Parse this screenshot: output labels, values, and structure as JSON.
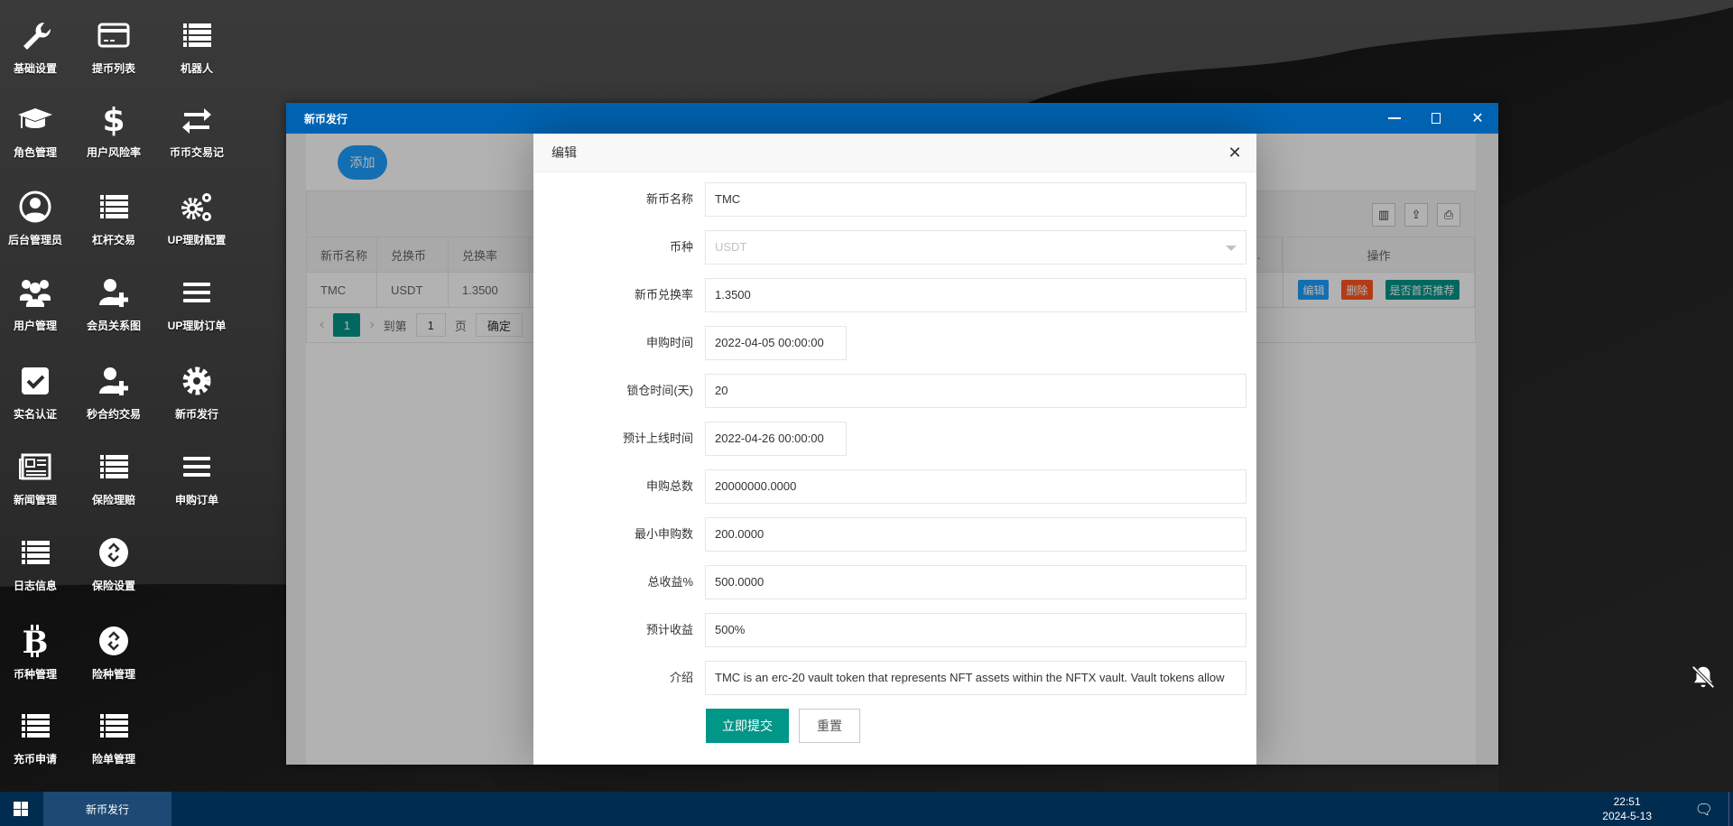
{
  "desktop": {
    "icons": [
      {
        "label": "基础设置",
        "icon": "wrench-icon"
      },
      {
        "label": "提币列表",
        "icon": "credit-card-icon"
      },
      {
        "label": "机器人",
        "icon": "list-icon"
      },
      {
        "label": "角色管理",
        "icon": "graduation-cap-icon"
      },
      {
        "label": "用户风险率",
        "icon": "dollar-icon"
      },
      {
        "label": "币币交易记",
        "icon": "exchange-icon"
      },
      {
        "label": "后台管理员",
        "icon": "user-circle-icon"
      },
      {
        "label": "杠杆交易",
        "icon": "list-icon"
      },
      {
        "label": "UP理财配置",
        "icon": "gears-icon"
      },
      {
        "label": "用户管理",
        "icon": "users-icon"
      },
      {
        "label": "会员关系图",
        "icon": "user-plus-icon"
      },
      {
        "label": "UP理财订单",
        "icon": "bars-icon"
      },
      {
        "label": "实名认证",
        "icon": "check-square-icon"
      },
      {
        "label": "秒合约交易",
        "icon": "user-plus-icon"
      },
      {
        "label": "新币发行",
        "icon": "gear-icon"
      },
      {
        "label": "新闻管理",
        "icon": "newspaper-icon"
      },
      {
        "label": "保险理赔",
        "icon": "list-icon"
      },
      {
        "label": "申购订单",
        "icon": "bars-icon"
      },
      {
        "label": "日志信息",
        "icon": "list-icon"
      },
      {
        "label": "保险设置",
        "icon": "link-circle-icon"
      },
      {
        "label": "币种管理",
        "icon": "bitcoin-icon"
      },
      {
        "label": "险种管理",
        "icon": "link-circle-icon"
      },
      {
        "label": "充币申请",
        "icon": "list-icon"
      },
      {
        "label": "险单管理",
        "icon": "list-icon"
      }
    ]
  },
  "window": {
    "title": "新币发行",
    "add_label": "添加",
    "table": {
      "columns": [
        "新币名称",
        "兑换币",
        "兑换率",
        "…",
        "操作"
      ],
      "rows": [
        {
          "name": "TMC",
          "currency": "USDT",
          "rate": "1.3500"
        }
      ],
      "actions": {
        "edit": "编辑",
        "delete": "删除",
        "recommend": "是否首页推荐"
      }
    },
    "pager": {
      "current": "1",
      "goto": "到第",
      "page_input": "1",
      "page_unit": "页",
      "confirm": "确定"
    }
  },
  "dialog": {
    "title": "编辑",
    "fields": [
      {
        "label": "新币名称",
        "value": "TMC",
        "type": "text"
      },
      {
        "label": "币种",
        "value": "USDT",
        "type": "select"
      },
      {
        "label": "新币兑换率",
        "value": "1.3500",
        "type": "text"
      },
      {
        "label": "申购时间",
        "value": "2022-04-05 00:00:00",
        "type": "date"
      },
      {
        "label": "锁仓时间(天)",
        "value": "20",
        "type": "text"
      },
      {
        "label": "预计上线时间",
        "value": "2022-04-26 00:00:00",
        "type": "date"
      },
      {
        "label": "申购总数",
        "value": "20000000.0000",
        "type": "text"
      },
      {
        "label": "最小申购数",
        "value": "200.0000",
        "type": "text"
      },
      {
        "label": "总收益%",
        "value": "500.0000",
        "type": "text"
      },
      {
        "label": "预计收益",
        "value": "500%",
        "type": "text"
      },
      {
        "label": "介绍",
        "value": "TMC is an erc-20 vault token that represents NFT assets within the NFTX vault. Vault tokens allow",
        "type": "text"
      }
    ],
    "submit_label": "立即提交",
    "reset_label": "重置"
  },
  "taskbar": {
    "active_task": "新币发行",
    "time": "22:51",
    "date": "2024-5-13"
  },
  "colors": {
    "titlebar": "#0063b1",
    "primary": "#1E9FFF",
    "success": "#009688",
    "danger": "#FF5722",
    "taskbar": "#002c50"
  }
}
